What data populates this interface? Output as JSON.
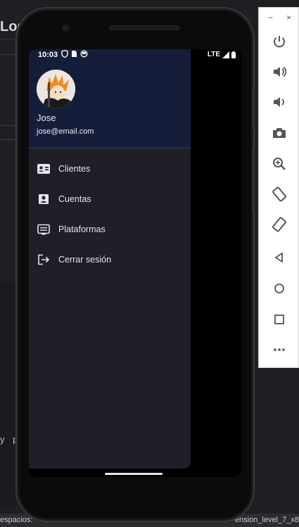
{
  "ide": {
    "title_fragment": "Log",
    "text_fragment": "y p",
    "status_left": "espacios: ",
    "status_right": "ension_level_7_x8"
  },
  "device": {
    "status_time": "10:03",
    "network": "LTE"
  },
  "drawer": {
    "user_name": "Jose",
    "user_email": "jose@email.com",
    "items": [
      {
        "label": "Clientes",
        "icon": "contact-card-icon"
      },
      {
        "label": "Cuentas",
        "icon": "account-box-icon"
      },
      {
        "label": "Plataformas",
        "icon": "list-alt-icon"
      },
      {
        "label": "Cerrar sesión",
        "icon": "logout-icon"
      }
    ]
  },
  "toolbar": {
    "minimize": "−",
    "close": "×",
    "buttons": [
      "power-icon",
      "volume-up-icon",
      "volume-down-icon",
      "camera-icon",
      "zoom-icon",
      "rotate-left-icon",
      "rotate-right-icon",
      "back-icon",
      "home-icon",
      "overview-icon",
      "more-icon"
    ]
  },
  "colors": {
    "accent": "#4a90d9",
    "drawer_header": "#161d3b",
    "drawer_bg": "#1f1f28"
  }
}
